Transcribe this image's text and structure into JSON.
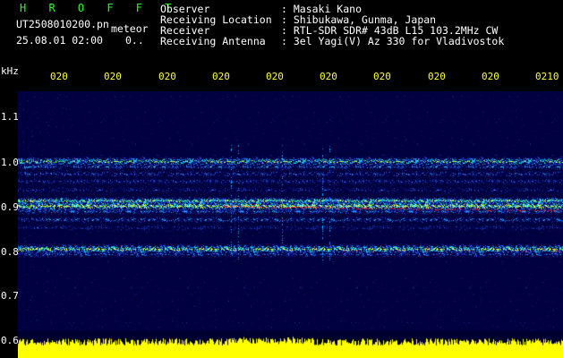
{
  "header": {
    "app_name": "H R O F F T",
    "filename": "UT2508010200.pn",
    "mode": "meteor",
    "datetime": "25.08.01 02:00",
    "marker": "0..",
    "fields": [
      {
        "label": "Observer",
        "value": ": Masaki Kano"
      },
      {
        "label": "Receiving Location",
        "value": ": Shibukawa, Gunma, Japan"
      },
      {
        "label": "Receiver",
        "value": ": RTL-SDR SDR# 43dB L15 103.2MHz CW"
      },
      {
        "label": "Receiving Antenna",
        "value": ": 3el Yagi(V) Az 330 for Vladivostok"
      }
    ]
  },
  "time_axis": {
    "labels": [
      "020",
      "020",
      "020",
      "020",
      "020",
      "020",
      "020",
      "020",
      "020",
      "0210"
    ]
  },
  "freq_axis": {
    "unit": "kHz",
    "labels": [
      "1.1",
      "1.0",
      "0.9",
      "0.8",
      "0.7",
      "0.6"
    ]
  },
  "colors": {
    "header_green": "#22ff22",
    "tick_yellow": "#ffff33",
    "background_navy": "#000040",
    "power_yellow": "#ffff00",
    "trace_red": "#ff2020"
  }
}
